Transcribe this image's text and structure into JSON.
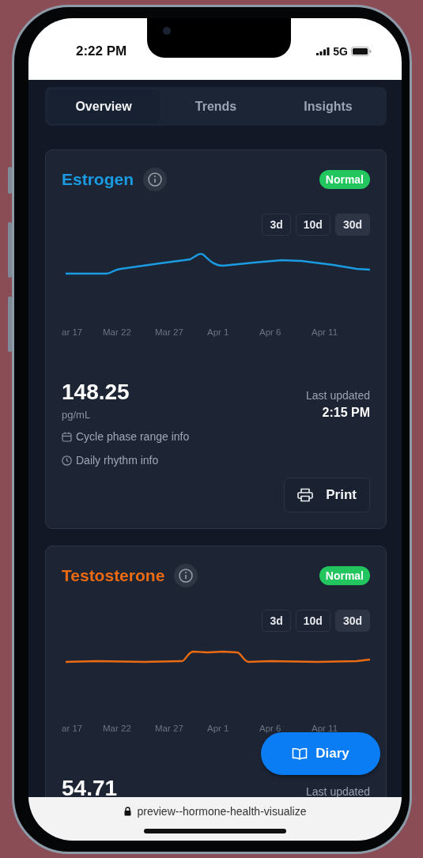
{
  "status_bar": {
    "time": "2:22 PM",
    "network": "5G"
  },
  "tabs": [
    {
      "label": "Overview",
      "selected": true
    },
    {
      "label": "Trends",
      "selected": false
    },
    {
      "label": "Insights",
      "selected": false
    }
  ],
  "cards": [
    {
      "kind": "estrogen",
      "title": "Estrogen",
      "color": "#1a9be2",
      "status": "Normal",
      "ranges": [
        {
          "label": "3d",
          "selected": false
        },
        {
          "label": "10d",
          "selected": false
        },
        {
          "label": "30d",
          "selected": true
        }
      ],
      "x_labels": [
        "ar 17",
        "Mar 22",
        "Mar 27",
        "Apr 1",
        "Apr 6",
        "Apr 11"
      ],
      "value": "148.25",
      "unit": "pg/mL",
      "updated_label": "Last updated",
      "updated_time": "2:15 PM",
      "info": [
        {
          "kind": "calendar",
          "text": "Cycle phase range info"
        },
        {
          "kind": "clock",
          "text": "Daily rhythm info"
        }
      ],
      "print": "Print"
    },
    {
      "kind": "testosterone",
      "title": "Testosterone",
      "color": "#ec6a12",
      "status": "Normal",
      "ranges": [
        {
          "label": "3d",
          "selected": false
        },
        {
          "label": "10d",
          "selected": false
        },
        {
          "label": "30d",
          "selected": true
        }
      ],
      "x_labels": [
        "ar 17",
        "Mar 22",
        "Mar 27",
        "Apr 1",
        "Apr 6",
        "Apr 11"
      ],
      "value": "54.71",
      "updated_label": "Last updated"
    }
  ],
  "diary_button": "Diary",
  "url_bar": {
    "url": "preview--hormone-health-visualize"
  }
}
